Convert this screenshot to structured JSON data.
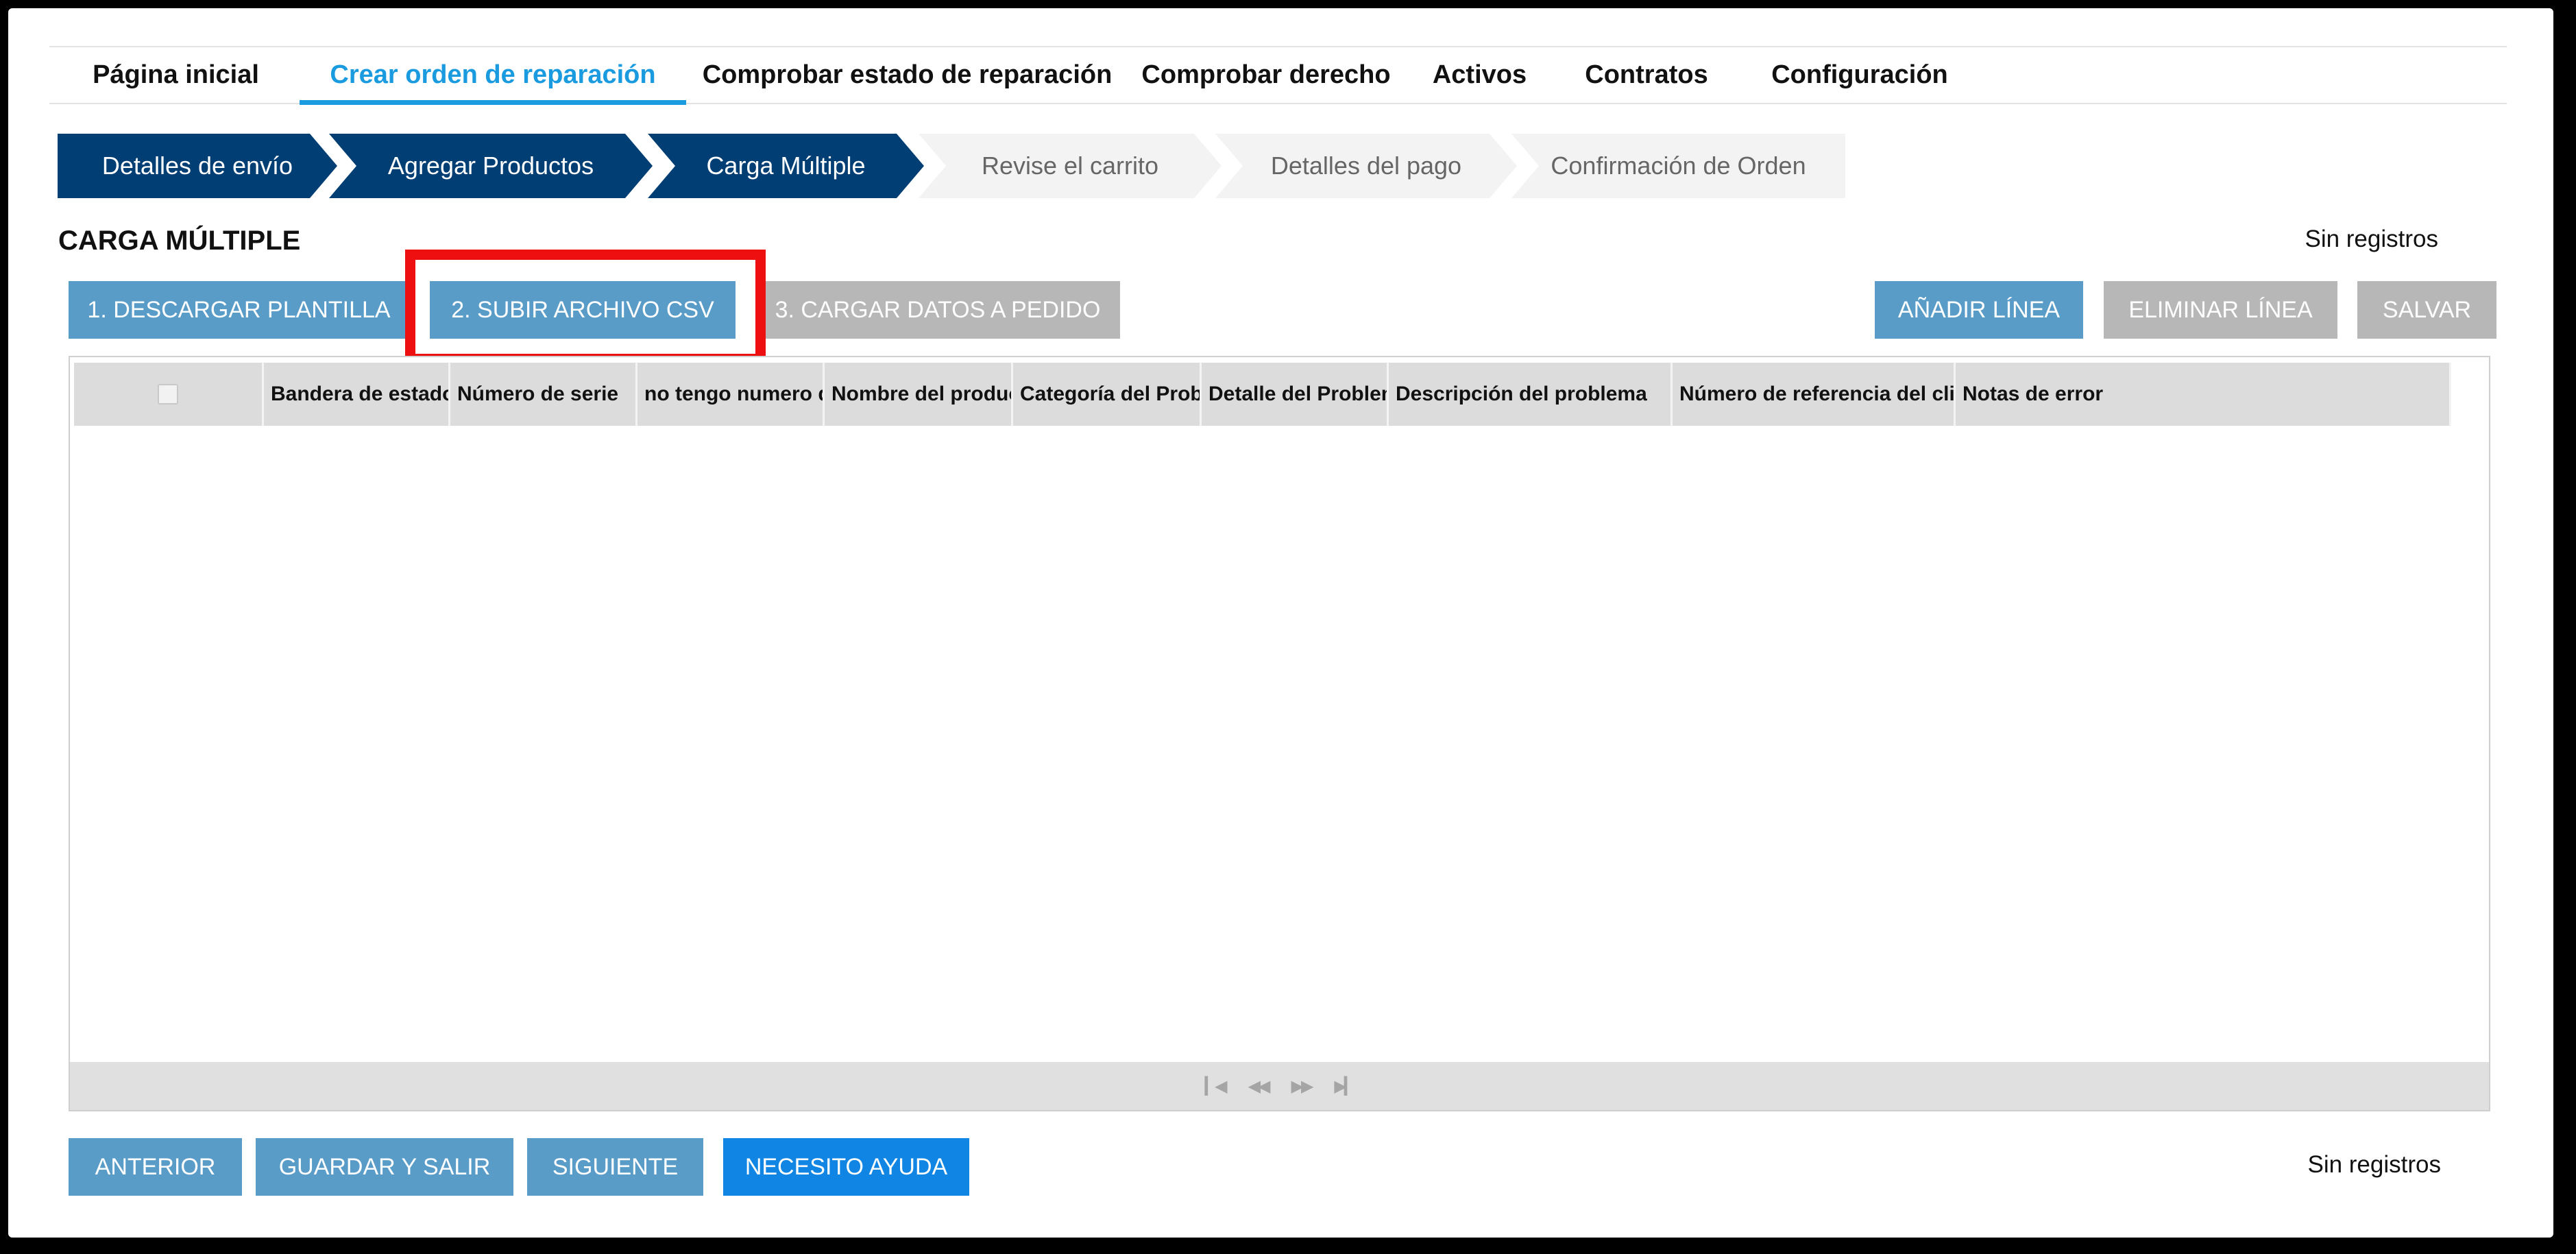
{
  "nav": {
    "tabs": [
      {
        "label": "Página inicial"
      },
      {
        "label": "Crear orden de reparación"
      },
      {
        "label": "Comprobar estado de reparación"
      },
      {
        "label": "Comprobar derecho"
      },
      {
        "label": "Activos"
      },
      {
        "label": "Contratos"
      },
      {
        "label": "Configuración"
      }
    ],
    "active": "Crear orden de reparación"
  },
  "steps": [
    {
      "label": "Detalles de envío",
      "state": "done"
    },
    {
      "label": "Agregar Productos",
      "state": "done"
    },
    {
      "label": "Carga Múltiple",
      "state": "current"
    },
    {
      "label": "Revise el carrito",
      "state": "pending"
    },
    {
      "label": "Detalles del pago",
      "state": "pending"
    },
    {
      "label": "Confirmación de Orden",
      "state": "pending"
    }
  ],
  "section": {
    "title": "CARGA MÚLTIPLE",
    "records_top": "Sin registros",
    "records_bottom": "Sin registros"
  },
  "toolbar": {
    "download_template": "1. DESCARGAR PLANTILLA",
    "upload_csv": "2. SUBIR ARCHIVO CSV",
    "load_data": "3. CARGAR DATOS A PEDIDO",
    "add_line": "AÑADIR LÍNEA",
    "delete_line": "ELIMINAR LÍNEA",
    "save": "SALVAR"
  },
  "grid": {
    "columns": [
      "Bandera de estado",
      "Número de serie",
      "no tengo numero de serie",
      "Nombre del producto",
      "Categoría del Problema",
      "Detalle del Problema",
      "Descripción del problema",
      "Número de referencia del cliente",
      "Notas de error"
    ],
    "rows": []
  },
  "footer": {
    "previous": "ANTERIOR",
    "save_exit": "GUARDAR Y SALIR",
    "next": "SIGUIENTE",
    "help": "NECESITO AYUDA"
  },
  "colors": {
    "accent": "#1a9be0",
    "step_done": "#003e74",
    "button_blue": "#5a9cc8",
    "button_disabled": "#b7b7b7",
    "button_primary": "#1185e4",
    "highlight": "#ee1010"
  }
}
